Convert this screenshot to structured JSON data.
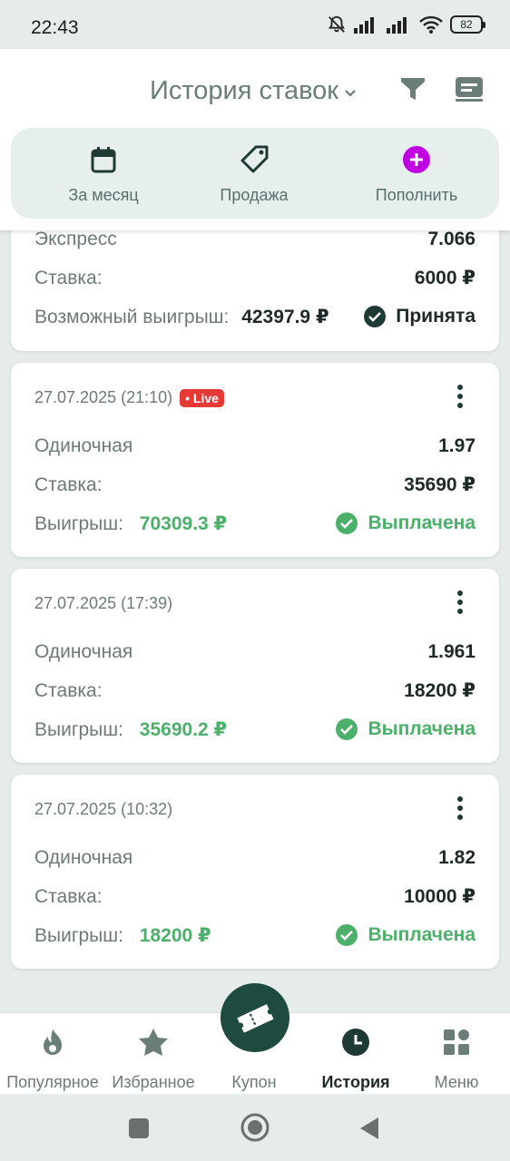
{
  "status_bar": {
    "time": "22:43",
    "battery": "82"
  },
  "header": {
    "title": "История ставок"
  },
  "quick_actions": [
    {
      "label": "За месяц",
      "icon": "calendar-icon"
    },
    {
      "label": "Продажа",
      "icon": "tag-icon"
    },
    {
      "label": "Пополнить",
      "icon": "plus-circle-icon"
    }
  ],
  "bets": [
    {
      "type": "Экспресс",
      "odds": "7.066",
      "stake_label": "Ставка:",
      "stake": "6000 ₽",
      "payout_label": "Возможный выигрыш:",
      "payout": "42397.9 ₽",
      "status": "Принята"
    },
    {
      "date": "27.07.2025 (21:10)",
      "live": "Live",
      "type": "Одиночная",
      "odds": "1.97",
      "stake_label": "Ставка:",
      "stake": "35690 ₽",
      "payout_label": "Выигрыш:",
      "payout": "70309.3 ₽",
      "status": "Выплачена"
    },
    {
      "date": "27.07.2025 (17:39)",
      "type": "Одиночная",
      "odds": "1.961",
      "stake_label": "Ставка:",
      "stake": "18200 ₽",
      "payout_label": "Выигрыш:",
      "payout": "35690.2 ₽",
      "status": "Выплачена"
    },
    {
      "date": "27.07.2025 (10:32)",
      "type": "Одиночная",
      "odds": "1.82",
      "stake_label": "Ставка:",
      "stake": "10000 ₽",
      "payout_label": "Выигрыш:",
      "payout": "18200 ₽",
      "status": "Выплачена"
    }
  ],
  "bottom_nav": [
    {
      "label": "Популярное",
      "icon": "flame-icon"
    },
    {
      "label": "Избранное",
      "icon": "star-icon"
    },
    {
      "label": "Купон",
      "icon": "ticket-icon"
    },
    {
      "label": "История",
      "icon": "clock-icon",
      "active": true
    },
    {
      "label": "Меню",
      "icon": "grid-icon"
    }
  ],
  "colors": {
    "accent": "#1e4a3f",
    "win": "#4caf6a",
    "live": "#e53935",
    "topup": "#c000e0"
  }
}
